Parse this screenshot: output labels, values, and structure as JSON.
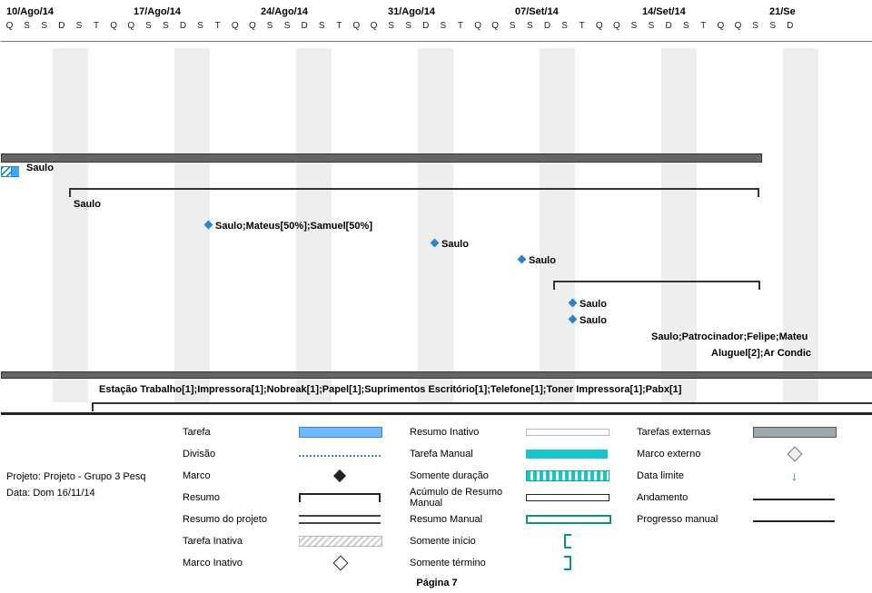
{
  "timeline": {
    "dates": [
      "10/Ago/14",
      "17/Ago/14",
      "24/Ago/14",
      "31/Ago/14",
      "07/Set/14",
      "14/Set/14",
      "21/Se"
    ],
    "days_pattern": [
      "Q",
      "S",
      "S",
      "D",
      "S",
      "T",
      "Q",
      "Q",
      "S",
      "S",
      "D",
      "S",
      "T",
      "Q",
      "Q",
      "S",
      "S",
      "D",
      "S",
      "T",
      "Q",
      "Q",
      "S",
      "S",
      "D",
      "S",
      "T",
      "Q",
      "Q",
      "S",
      "S",
      "D",
      "S",
      "T",
      "Q",
      "Q",
      "S",
      "S",
      "D",
      "S",
      "T",
      "Q",
      "Q",
      "S",
      "S",
      "D"
    ]
  },
  "tasks": {
    "t1_label": "Saulo",
    "t2_label": "Saulo",
    "t3_label": "Saulo;Mateus[50%];Samuel[50%]",
    "t4_label": "Saulo",
    "t5_label": "Saulo",
    "t6_label": "Saulo",
    "t7_label": "Saulo",
    "t8_label": "Saulo;Patrocinador;Felipe;Mateu",
    "t9_label": "Aluguel[2];Ar Condic",
    "t10_label": "Estação Trabalho[1];Impressora[1];Nobreak[1];Papel[1];Suprimentos Escritório[1];Telefone[1];Toner Impressora[1];Pabx[1]"
  },
  "project": {
    "name_prefix": "Projeto: ",
    "name": "Projeto - Grupo 3 Pesq",
    "date_prefix": "Data: ",
    "date": "Dom 16/11/14"
  },
  "legend": {
    "c1": [
      "Tarefa",
      "Divisão",
      "Marco",
      "Resumo",
      "Resumo do projeto",
      "Tarefa Inativa",
      "Marco Inativo"
    ],
    "c2": [
      "Resumo Inativo",
      "Tarefa Manual",
      "Somente duração",
      "Acúmulo de Resumo Manual",
      "Resumo Manual",
      "Somente início",
      "Somente término"
    ],
    "c3": [
      "Tarefas externas",
      "Marco externo",
      "Data limite",
      "Andamento",
      "Progresso manual"
    ]
  },
  "footer": "Página 7"
}
